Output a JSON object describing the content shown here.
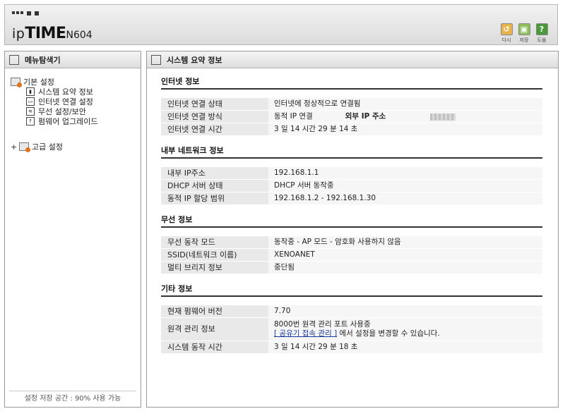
{
  "header": {
    "logo_ip": "ip",
    "logo_time": "TIME",
    "logo_model": "N604",
    "buttons": [
      {
        "label": "다시",
        "icon": "refresh-icon",
        "color": "#e8b34a",
        "glyph": "↺"
      },
      {
        "label": "저장",
        "icon": "save-icon",
        "color": "#8fbf5a",
        "glyph": "▣"
      },
      {
        "label": "도움",
        "icon": "help-icon",
        "color": "#4a9a3a",
        "glyph": "?"
      }
    ]
  },
  "left": {
    "title": "메뉴탐색기",
    "tree": {
      "basic": "기본 설정",
      "items": [
        "시스템 요약 정보",
        "인터넷 연결 설정",
        "무선 설정/보안",
        "펌웨어 업그레이드"
      ],
      "advanced": "고급 설정"
    },
    "footer": "설정 저장 공간 : 90% 사용 가능"
  },
  "right": {
    "title": "시스템 요약 정보",
    "sections": {
      "internet": {
        "title": "인터넷 정보",
        "status_k": "인터넷 연결 상태",
        "status_v": "인터넷에 정상적으로 연결됨",
        "method_k": "인터넷 연결 방식",
        "method_v": "동적 IP 연결",
        "ext_ip_k": "외부 IP 주소",
        "time_k": "인터넷 연결 시간",
        "time_v": "3 일 14 시간 29 분 14 초"
      },
      "lan": {
        "title": "내부 네트워크 정보",
        "ip_k": "내부 IP주소",
        "ip_v": "192.168.1.1",
        "dhcp_k": "DHCP 서버 상태",
        "dhcp_v": "DHCP 서버 동작중",
        "range_k": "동적 IP 할당 범위",
        "range_v": "192.168.1.2 -  192.168.1.30"
      },
      "wireless": {
        "title": "무선 정보",
        "mode_k": "무선 동작 모드",
        "mode_v": "동작중 - AP 모드 - 암호화 사용하지 않음",
        "ssid_k": "SSID(네트워크 이름)",
        "ssid_v": "XENOANET",
        "bridge_k": "멀티 브리지 정보",
        "bridge_v": "중단됨"
      },
      "etc": {
        "title": "기타 정보",
        "fw_k": "현재 펌웨어 버전",
        "fw_v": "7.70",
        "remote_k": "원격 관리 정보",
        "remote_v1": "8000번 원격 관리 포트 사용중",
        "remote_link": "[ 공유기 접속 관리 ]",
        "remote_v2": " 에서 설정을 변경할 수 있습니다.",
        "uptime_k": "시스템 동작 시간",
        "uptime_v": "3 일 14 시간 29 분 18 초"
      }
    }
  }
}
